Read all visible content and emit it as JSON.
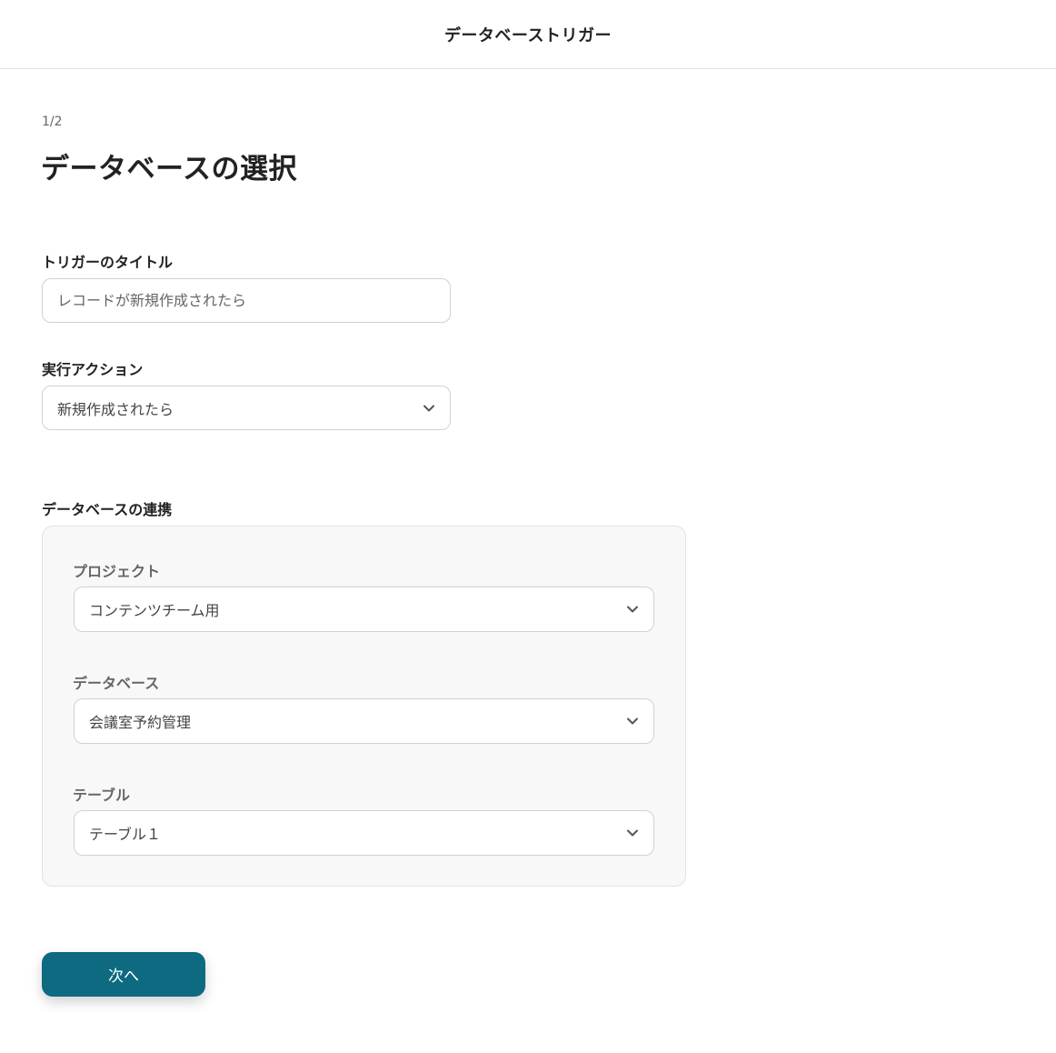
{
  "header": {
    "title": "データベーストリガー"
  },
  "step": "1/2",
  "page_title": "データベースの選択",
  "trigger_title": {
    "label": "トリガーのタイトル",
    "placeholder": "レコードが新規作成されたら",
    "value": ""
  },
  "action": {
    "label": "実行アクション",
    "selected": "新規作成されたら"
  },
  "db_link": {
    "label": "データベースの連携",
    "project": {
      "label": "プロジェクト",
      "selected": "コンテンツチーム用"
    },
    "database": {
      "label": "データベース",
      "selected": "会議室予約管理"
    },
    "table": {
      "label": "テーブル",
      "selected": "テーブル１"
    }
  },
  "next_button": {
    "label": "次へ"
  },
  "colors": {
    "primary": "#0d6a80",
    "panel_bg": "#f8f8f8",
    "border": "#c9d3dc"
  },
  "icons": {
    "select_arrow": "chevron-down-icon"
  }
}
